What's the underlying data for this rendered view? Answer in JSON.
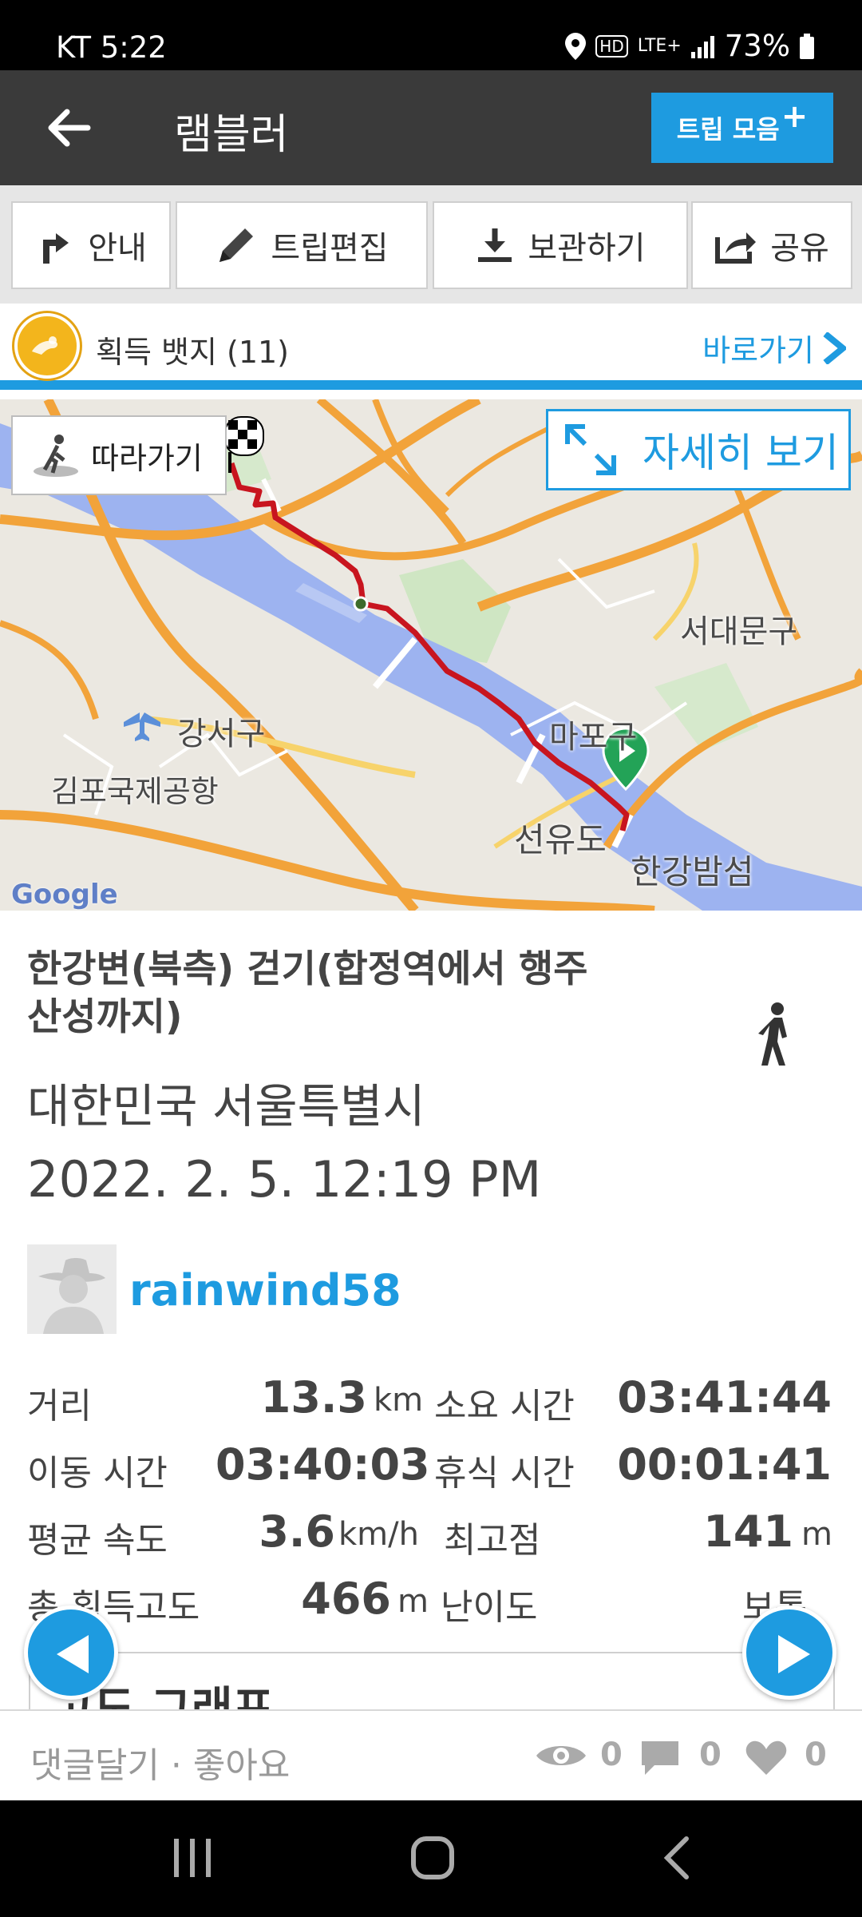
{
  "status_bar": {
    "carrier_time": "KT  5:22",
    "network": "LTE+",
    "battery": "73%"
  },
  "app_bar": {
    "title": "램블러",
    "trip_collection_label": "트립 모음",
    "trip_collection_plus": "+"
  },
  "toolbar": {
    "guide_label": "안내",
    "edit_label": "트립편집",
    "save_label": "보관하기",
    "share_label": "공유"
  },
  "badges": {
    "label": "획득 뱃지 (11)",
    "goto_label": "바로가기"
  },
  "map": {
    "follow_label": "따라가기",
    "detail_label": "자세히 보기",
    "labels": {
      "seodaemun": "서대문구",
      "gangseo": "강서구",
      "gimpo": "김포국제공항",
      "mapo": "마포구",
      "seonyudo": "선유도",
      "hangang_bamseom": "한강밤섬"
    },
    "attribution": "Google"
  },
  "trip": {
    "title": "한강변(북측) 걷기(합정역에서 행주산성까지)",
    "location": "대한민국 서울특별시",
    "datetime": "2022. 2. 5. 12:19 PM",
    "username": "rainwind58"
  },
  "stats": {
    "distance_label": "거리",
    "distance_value": "13.3",
    "distance_unit": "km",
    "duration_label": "소요 시간",
    "duration_value": "03:41:44",
    "moving_label": "이동 시간",
    "moving_value": "03:40:03",
    "rest_label": "휴식 시간",
    "rest_value": "00:01:41",
    "speed_label": "평균 속도",
    "speed_value": "3.6",
    "speed_unit": "km/h",
    "highest_label": "최고점",
    "highest_value": "141",
    "highest_unit": "m",
    "elevation_label": "총 획득고도",
    "elevation_value": "466",
    "elevation_unit": "m",
    "difficulty_label": "난이도",
    "difficulty_value": "보통"
  },
  "graph": {
    "title": "고도 그래프"
  },
  "bottom_bar": {
    "comment_like": "댓글달기 · 좋아요",
    "views": "0",
    "comments": "0",
    "likes": "0"
  }
}
